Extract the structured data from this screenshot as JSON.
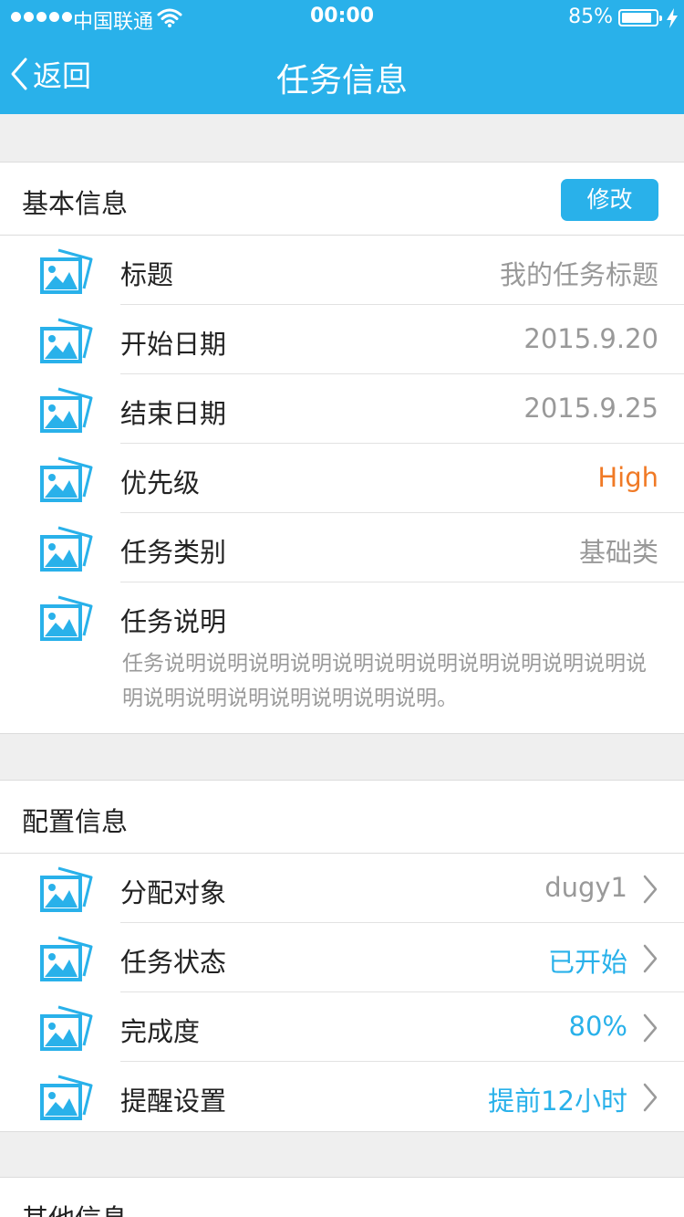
{
  "status_bar": {
    "carrier": "中国联通",
    "time": "00:00",
    "battery": "85%"
  },
  "nav": {
    "back_label": "返回",
    "title": "任务信息"
  },
  "basic": {
    "title": "基本信息",
    "edit_label": "修改",
    "rows": [
      {
        "label": "标题",
        "value": "我的任务标题"
      },
      {
        "label": "开始日期",
        "value": "2015.9.20"
      },
      {
        "label": "结束日期",
        "value": "2015.9.25"
      },
      {
        "label": "优先级",
        "value": "High"
      },
      {
        "label": "任务类别",
        "value": "基础类"
      }
    ],
    "description": {
      "label": "任务说明",
      "text": "任务说明说明说明说明说明说明说明说明说明说明说明说明说明说明说明说明说明说明说明。"
    }
  },
  "config": {
    "title": "配置信息",
    "rows": [
      {
        "label": "分配对象",
        "value": "dugy1"
      },
      {
        "label": "任务状态",
        "value": "已开始"
      },
      {
        "label": "完成度",
        "value": "80%"
      },
      {
        "label": "提醒设置",
        "value": "提前12小时"
      }
    ]
  },
  "other": {
    "title": "其他信息"
  },
  "icons": {
    "row_icon": "image-icon",
    "accent": "#29b1ea",
    "priority_color": "#f07a26"
  }
}
